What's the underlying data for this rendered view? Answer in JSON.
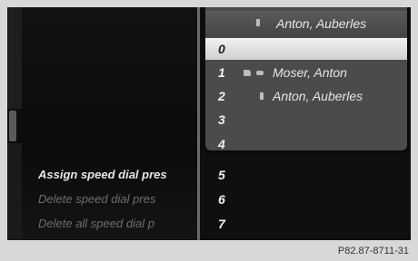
{
  "menu": {
    "items": [
      {
        "label": "Assign speed dial pres",
        "state": "active"
      },
      {
        "label": "Delete speed dial pres",
        "state": "dim"
      },
      {
        "label": "Delete all speed dial p",
        "state": "dim"
      }
    ]
  },
  "speed_dial": {
    "header": "Anton, Auberles",
    "rows": [
      {
        "number": "0",
        "name": "",
        "selected": true
      },
      {
        "number": "1",
        "name": "Moser, Anton",
        "icons": [
          "hand-icon",
          "phone-icon"
        ]
      },
      {
        "number": "2",
        "name": "Anton, Auberles",
        "icons": [
          "small-icon"
        ]
      },
      {
        "number": "3",
        "name": ""
      },
      {
        "number": "4",
        "name": ""
      },
      {
        "number": "5",
        "name": ""
      },
      {
        "number": "6",
        "name": ""
      },
      {
        "number": "7",
        "name": ""
      }
    ]
  },
  "footer": {
    "code": "P82.87-8711-31"
  },
  "colors": {
    "screen_bg": "#0d0d0d",
    "popup_bg": "#4b4b4b",
    "selected_bg": "#e6e6e6",
    "page_bg": "#d8d8d8"
  }
}
